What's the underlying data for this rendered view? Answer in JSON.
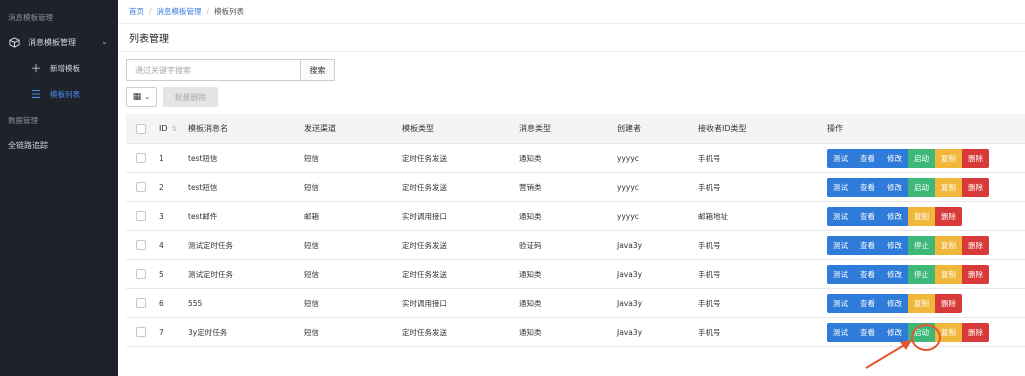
{
  "sidebar": {
    "section1": "消息模板管理",
    "group": {
      "label": "消息模板管理",
      "icon": "cube-icon"
    },
    "sub_items": [
      {
        "label": "新增模板",
        "icon": "plus-icon",
        "active": false
      },
      {
        "label": "模板列表",
        "icon": "list-icon",
        "active": true
      }
    ],
    "section2": "数据管理",
    "item_trace": "全链路追踪"
  },
  "breadcrumb": {
    "home": "首页",
    "parent": "消息模板管理",
    "current": "模板列表"
  },
  "page_title": "列表管理",
  "search": {
    "placeholder": "通过关键字搜索",
    "button": "搜索"
  },
  "toolbar": {
    "batch_delete": "批量删除"
  },
  "table": {
    "headers": {
      "id": "ID",
      "name": "模板消息名",
      "channel": "发送渠道",
      "type": "模板类型",
      "msg_type": "消息类型",
      "creator": "创建者",
      "receiver": "接收者ID类型",
      "ops": "操作"
    },
    "rows": [
      {
        "id": "1",
        "name": "test短信",
        "channel": "短信",
        "type": "定时任务发送",
        "msg_type": "通知类",
        "creator": "yyyyc",
        "receiver": "手机号",
        "ops": [
          {
            "label": "测试",
            "color": "blue"
          },
          {
            "label": "查看",
            "color": "blue"
          },
          {
            "label": "修改",
            "color": "blue"
          },
          {
            "label": "启动",
            "color": "green"
          },
          {
            "label": "复制",
            "color": "yellow"
          },
          {
            "label": "删除",
            "color": "red"
          }
        ]
      },
      {
        "id": "2",
        "name": "test短信",
        "channel": "短信",
        "type": "定时任务发送",
        "msg_type": "营销类",
        "creator": "yyyyc",
        "receiver": "手机号",
        "ops": [
          {
            "label": "测试",
            "color": "blue"
          },
          {
            "label": "查看",
            "color": "blue"
          },
          {
            "label": "修改",
            "color": "blue"
          },
          {
            "label": "启动",
            "color": "green"
          },
          {
            "label": "复制",
            "color": "yellow"
          },
          {
            "label": "删除",
            "color": "red"
          }
        ]
      },
      {
        "id": "3",
        "name": "test邮件",
        "channel": "邮箱",
        "type": "实时调用接口",
        "msg_type": "通知类",
        "creator": "yyyyc",
        "receiver": "邮箱地址",
        "ops": [
          {
            "label": "测试",
            "color": "blue"
          },
          {
            "label": "查看",
            "color": "blue"
          },
          {
            "label": "修改",
            "color": "blue"
          },
          {
            "label": "复制",
            "color": "yellow"
          },
          {
            "label": "删除",
            "color": "red"
          }
        ]
      },
      {
        "id": "4",
        "name": "测试定时任务",
        "channel": "短信",
        "type": "定时任务发送",
        "msg_type": "验证码",
        "creator": "Java3y",
        "receiver": "手机号",
        "ops": [
          {
            "label": "测试",
            "color": "blue"
          },
          {
            "label": "查看",
            "color": "blue"
          },
          {
            "label": "修改",
            "color": "blue"
          },
          {
            "label": "停止",
            "color": "green"
          },
          {
            "label": "复制",
            "color": "yellow"
          },
          {
            "label": "删除",
            "color": "red"
          }
        ]
      },
      {
        "id": "5",
        "name": "测试定时任务",
        "channel": "短信",
        "type": "定时任务发送",
        "msg_type": "通知类",
        "creator": "Java3y",
        "receiver": "手机号",
        "ops": [
          {
            "label": "测试",
            "color": "blue"
          },
          {
            "label": "查看",
            "color": "blue"
          },
          {
            "label": "修改",
            "color": "blue"
          },
          {
            "label": "停止",
            "color": "green"
          },
          {
            "label": "复制",
            "color": "yellow"
          },
          {
            "label": "删除",
            "color": "red"
          }
        ]
      },
      {
        "id": "6",
        "name": "555",
        "channel": "短信",
        "type": "实时调用接口",
        "msg_type": "通知类",
        "creator": "Java3y",
        "receiver": "手机号",
        "ops": [
          {
            "label": "测试",
            "color": "blue"
          },
          {
            "label": "查看",
            "color": "blue"
          },
          {
            "label": "修改",
            "color": "blue"
          },
          {
            "label": "复制",
            "color": "yellow"
          },
          {
            "label": "删除",
            "color": "red"
          }
        ]
      },
      {
        "id": "7",
        "name": "3y定时任务",
        "channel": "短信",
        "type": "定时任务发送",
        "msg_type": "通知类",
        "creator": "Java3y",
        "receiver": "手机号",
        "ops": [
          {
            "label": "测试",
            "color": "blue"
          },
          {
            "label": "查看",
            "color": "blue"
          },
          {
            "label": "修改",
            "color": "blue"
          },
          {
            "label": "启动",
            "color": "green"
          },
          {
            "label": "复制",
            "color": "yellow"
          },
          {
            "label": "删除",
            "color": "red"
          }
        ]
      }
    ]
  },
  "annotation_color": "#e2572f"
}
